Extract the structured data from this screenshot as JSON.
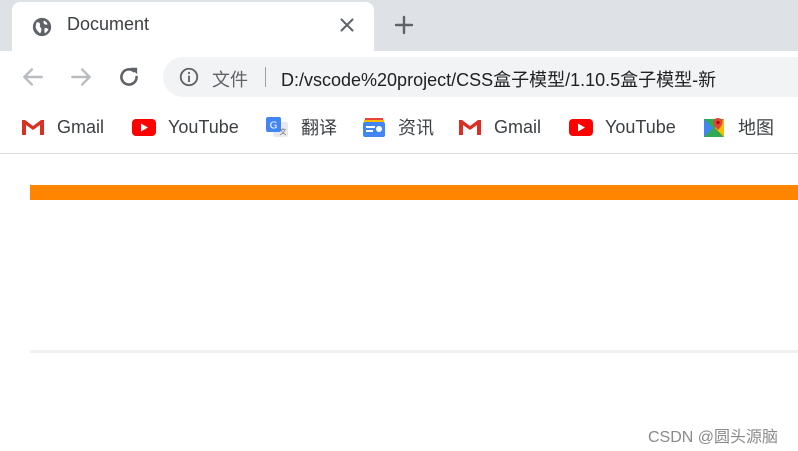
{
  "tab": {
    "title": "Document",
    "icon": "globe-icon"
  },
  "toolbar": {
    "scheme_label": "文件",
    "url": "D:/vscode%20project/CSS盒子模型/1.10.5盒子模型-新"
  },
  "bookmarks": [
    {
      "label": "Gmail",
      "icon": "gmail-icon"
    },
    {
      "label": "YouTube",
      "icon": "youtube-icon"
    },
    {
      "label": "翻译",
      "icon": "translate-icon"
    },
    {
      "label": "资讯",
      "icon": "news-icon"
    },
    {
      "label": "Gmail",
      "icon": "gmail-icon"
    },
    {
      "label": "YouTube",
      "icon": "youtube-icon"
    },
    {
      "label": "地图",
      "icon": "maps-icon"
    }
  ],
  "page": {
    "accent_bar_color": "#ff8400",
    "divider_color": "#f0f0f0"
  },
  "watermark": "CSDN @圆头源脑"
}
